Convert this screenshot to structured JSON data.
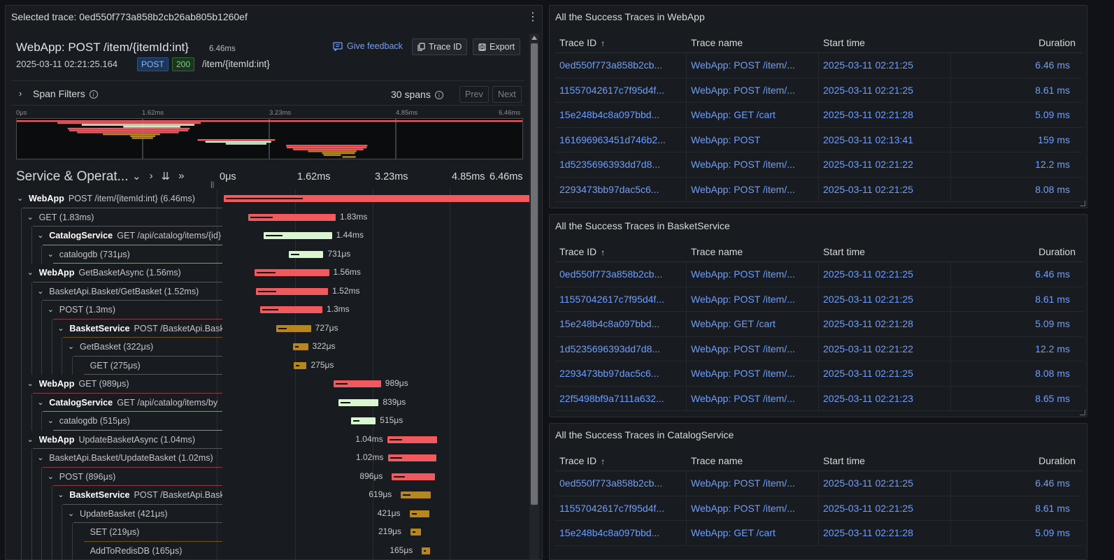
{
  "trace_panel": {
    "header": "Selected trace: 0ed550f773a858b2cb26ab805b1260ef",
    "title": "WebApp: POST /item/{itemId:int}",
    "duration": "6.46ms",
    "start_time": "2025-03-11 02:21:25.164",
    "method_tag": "POST",
    "status_tag": "200",
    "path": "/item/{itemId:int}",
    "give_feedback": "Give feedback",
    "trace_id_btn": "Trace ID",
    "export_btn": "Export",
    "span_filters": "Span Filters",
    "spans_count": "30 spans",
    "prev": "Prev",
    "next": "Next",
    "minimap_ticks": [
      "0μs",
      "1.62ms",
      "3.23ms",
      "4.85ms",
      "6.46ms"
    ],
    "service_operation": "Service & Operat...",
    "timeline_ticks": [
      "0μs",
      "1.62ms",
      "3.23ms",
      "4.85ms",
      "6.46ms"
    ],
    "colors": {
      "webapp": "#f05a5f",
      "catalog": "#d9f5d2",
      "basket": "#b8871b"
    },
    "spans": [
      {
        "svc": "WebApp",
        "op": "POST /item/{itemId:int} (6.46ms)",
        "depth": 0,
        "color": "webapp",
        "start": 0.0,
        "end": 6.46,
        "label": ""
      },
      {
        "svc": "",
        "op": "GET (1.83ms)",
        "depth": 1,
        "color": "webapp",
        "start": 0.52,
        "end": 2.35,
        "label": "1.83ms"
      },
      {
        "svc": "CatalogService",
        "op": "GET /api/catalog/items/{id}",
        "depth": 2,
        "color": "catalog",
        "start": 0.83,
        "end": 2.27,
        "label": "1.44ms"
      },
      {
        "svc": "",
        "op": "catalogdb (731μs)",
        "depth": 3,
        "color": "catalog",
        "start": 1.36,
        "end": 2.09,
        "label": "731μs"
      },
      {
        "svc": "WebApp",
        "op": "GetBasketAsync (1.56ms)",
        "depth": 1,
        "color": "webapp",
        "start": 0.65,
        "end": 2.21,
        "label": "1.56ms"
      },
      {
        "svc": "",
        "op": "BasketApi.Basket/GetBasket (1.52ms)",
        "depth": 2,
        "color": "webapp",
        "start": 0.67,
        "end": 2.19,
        "label": "1.52ms"
      },
      {
        "svc": "",
        "op": "POST (1.3ms)",
        "depth": 3,
        "color": "webapp",
        "start": 0.77,
        "end": 2.07,
        "label": "1.3ms"
      },
      {
        "svc": "BasketService",
        "op": "POST /BasketApi.Basket/GetBasket",
        "depth": 4,
        "color": "basket",
        "start": 1.1,
        "end": 1.83,
        "label": "727μs"
      },
      {
        "svc": "",
        "op": "GetBasket (322μs)",
        "depth": 5,
        "color": "basket",
        "start": 1.45,
        "end": 1.77,
        "label": "322μs"
      },
      {
        "svc": "",
        "op": "GET (275μs)",
        "depth": 6,
        "color": "basket",
        "start": 1.47,
        "end": 1.74,
        "label": "275μs"
      },
      {
        "svc": "WebApp",
        "op": "GET (989μs)",
        "depth": 1,
        "color": "webapp",
        "start": 2.31,
        "end": 3.3,
        "label": "989μs"
      },
      {
        "svc": "CatalogService",
        "op": "GET /api/catalog/items/by",
        "depth": 2,
        "color": "catalog",
        "start": 2.41,
        "end": 3.25,
        "label": "839μs"
      },
      {
        "svc": "",
        "op": "catalogdb (515μs)",
        "depth": 3,
        "color": "catalog",
        "start": 2.67,
        "end": 3.19,
        "label": "515μs"
      },
      {
        "svc": "WebApp",
        "op": "UpdateBasketAsync (1.04ms)",
        "depth": 1,
        "color": "webapp",
        "start": 3.44,
        "end": 4.48,
        "label": "1.04ms"
      },
      {
        "svc": "",
        "op": "BasketApi.Basket/UpdateBasket (1.02ms)",
        "depth": 2,
        "color": "webapp",
        "start": 3.45,
        "end": 4.47,
        "label": "1.02ms"
      },
      {
        "svc": "",
        "op": "POST (896μs)",
        "depth": 3,
        "color": "webapp",
        "start": 3.53,
        "end": 4.43,
        "label": "896μs"
      },
      {
        "svc": "BasketService",
        "op": "POST /BasketApi.Basket/UpdateBasket",
        "depth": 4,
        "color": "basket",
        "start": 3.72,
        "end": 4.34,
        "label": "619μs"
      },
      {
        "svc": "",
        "op": "UpdateBasket (421μs)",
        "depth": 5,
        "color": "basket",
        "start": 3.9,
        "end": 4.32,
        "label": "421μs"
      },
      {
        "svc": "",
        "op": "SET (219μs)",
        "depth": 6,
        "color": "basket",
        "start": 3.92,
        "end": 4.14,
        "label": "219μs"
      },
      {
        "svc": "",
        "op": "AddToRedisDB (165μs)",
        "depth": 6,
        "color": "basket",
        "start": 4.16,
        "end": 4.33,
        "label": "165μs"
      }
    ]
  },
  "tables": [
    {
      "title": "All the Success Traces in WebApp",
      "headers": [
        "Trace ID",
        "Trace name",
        "Start time",
        "Duration"
      ],
      "rows": [
        [
          "0ed550f773a858b2cb...",
          "WebApp: POST /item/...",
          "2025-03-11 02:21:25",
          "6.46 ms"
        ],
        [
          "11557042617c7f95d4f...",
          "WebApp: POST /item/...",
          "2025-03-11 02:21:25",
          "8.61 ms"
        ],
        [
          "15e248b4c8a097bbd...",
          "WebApp: GET /cart",
          "2025-03-11 02:21:28",
          "5.09 ms"
        ],
        [
          "161696963451d746b2...",
          "WebApp: POST",
          "2025-03-11 02:13:41",
          "159 ms"
        ],
        [
          "1d5235696393dd7d8...",
          "WebApp: POST /item/...",
          "2025-03-11 02:21:22",
          "12.2 ms"
        ],
        [
          "2293473bb97dac5c6...",
          "WebApp: POST /item/...",
          "2025-03-11 02:21:25",
          "8.08 ms"
        ]
      ]
    },
    {
      "title": "All the Success Traces in BasketService",
      "headers": [
        "Trace ID",
        "Trace name",
        "Start time",
        "Duration"
      ],
      "rows": [
        [
          "0ed550f773a858b2cb...",
          "WebApp: POST /item/...",
          "2025-03-11 02:21:25",
          "6.46 ms"
        ],
        [
          "11557042617c7f95d4f...",
          "WebApp: POST /item/...",
          "2025-03-11 02:21:25",
          "8.61 ms"
        ],
        [
          "15e248b4c8a097bbd...",
          "WebApp: GET /cart",
          "2025-03-11 02:21:28",
          "5.09 ms"
        ],
        [
          "1d5235696393dd7d8...",
          "WebApp: POST /item/...",
          "2025-03-11 02:21:22",
          "12.2 ms"
        ],
        [
          "2293473bb97dac5c6...",
          "WebApp: POST /item/...",
          "2025-03-11 02:21:25",
          "8.08 ms"
        ],
        [
          "22f5498bf9a7111a632...",
          "WebApp: POST /item/...",
          "2025-03-11 02:21:23",
          "8.65 ms"
        ]
      ]
    },
    {
      "title": "All the Success Traces in CatalogService",
      "headers": [
        "Trace ID",
        "Trace name",
        "Start time",
        "Duration"
      ],
      "rows": [
        [
          "0ed550f773a858b2cb...",
          "WebApp: POST /item/...",
          "2025-03-11 02:21:25",
          "6.46 ms"
        ],
        [
          "11557042617c7f95d4f...",
          "WebApp: POST /item/...",
          "2025-03-11 02:21:25",
          "8.61 ms"
        ],
        [
          "15e248b4c8a097bbd...",
          "WebApp: GET /cart",
          "2025-03-11 02:21:28",
          "5.09 ms"
        ]
      ]
    }
  ]
}
